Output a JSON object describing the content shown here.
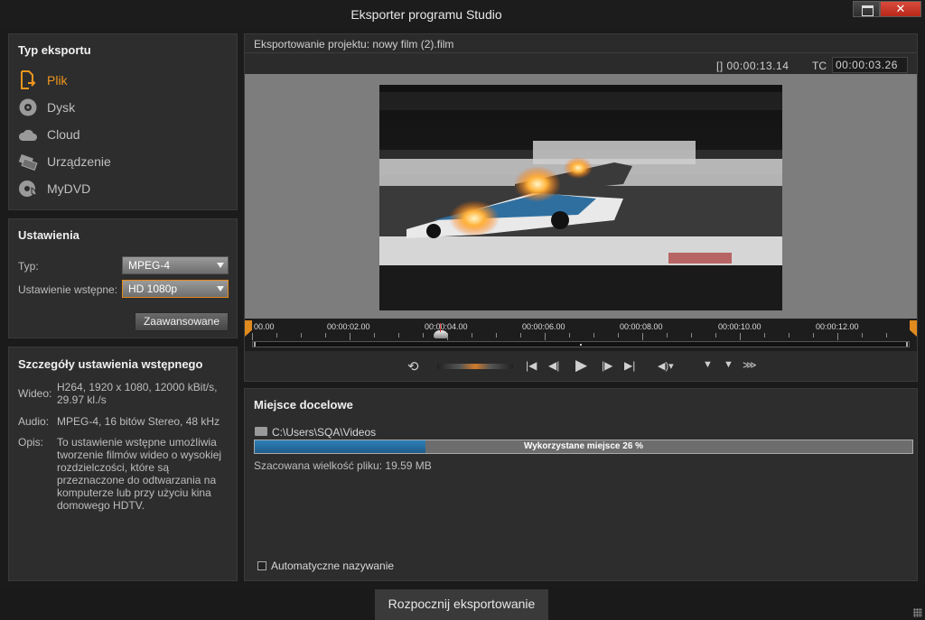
{
  "window": {
    "title": "Eksporter programu Studio",
    "close_icon": "✕"
  },
  "export_type": {
    "heading": "Typ eksportu",
    "items": [
      {
        "label": "Plik",
        "icon": "file-export-icon",
        "active": true
      },
      {
        "label": "Dysk",
        "icon": "disc-icon",
        "active": false
      },
      {
        "label": "Cloud",
        "icon": "cloud-icon",
        "active": false
      },
      {
        "label": "Urządzenie",
        "icon": "device-icon",
        "active": false
      },
      {
        "label": "MyDVD",
        "icon": "mydvd-icon",
        "active": false
      }
    ]
  },
  "settings": {
    "heading": "Ustawienia",
    "type_label": "Typ:",
    "type_value": "MPEG-4",
    "preset_label": "Ustawienie wstępne:",
    "preset_value": "HD 1080p",
    "advanced_button": "Zaawansowane"
  },
  "preset_details": {
    "heading": "Szczegóły ustawienia wstępnego",
    "video_label": "Wideo:",
    "video_value": "H264, 1920 x 1080, 12000 kBit/s, 29.97 kl./s",
    "audio_label": "Audio:",
    "audio_value": "MPEG-4, 16 bitów Stereo, 48 kHz",
    "desc_label": "Opis:",
    "desc_value": "To ustawienie wstępne umożliwia tworzenie filmów wideo o wysokiej rozdzielczości, które są przeznaczone do odtwarzania na komputerze lub przy użyciu kina domowego HDTV."
  },
  "preview": {
    "project_label": "Eksportowanie projektu: nowy film (2).film",
    "duration": "[] 00:00:13.14",
    "tc_label": "TC",
    "timecode": "00:00:03.26",
    "timeline_labels": [
      "00.00",
      "00:00:02.00",
      "00:00:04.00",
      "00:00:06.00",
      "00:00:08.00",
      "00:00:10.00",
      "00:00:12.00"
    ],
    "playhead_seconds": 3.87,
    "total_seconds": 13.47
  },
  "destination": {
    "heading": "Miejsce docelowe",
    "path": "C:\\Users\\SQA\\Videos",
    "usage_text": "Wykorzystane miejsce 26 %",
    "usage_fraction": 0.26,
    "estimated_size": "Szacowana wielkość pliku: 19.59 MB",
    "auto_naming_label": "Automatyczne nazywanie",
    "auto_naming_checked": false
  },
  "start_button": "Rozpocznij eksportowanie",
  "colors": {
    "accent": "#f0961e",
    "usage_fill": "#1f5d8a"
  }
}
